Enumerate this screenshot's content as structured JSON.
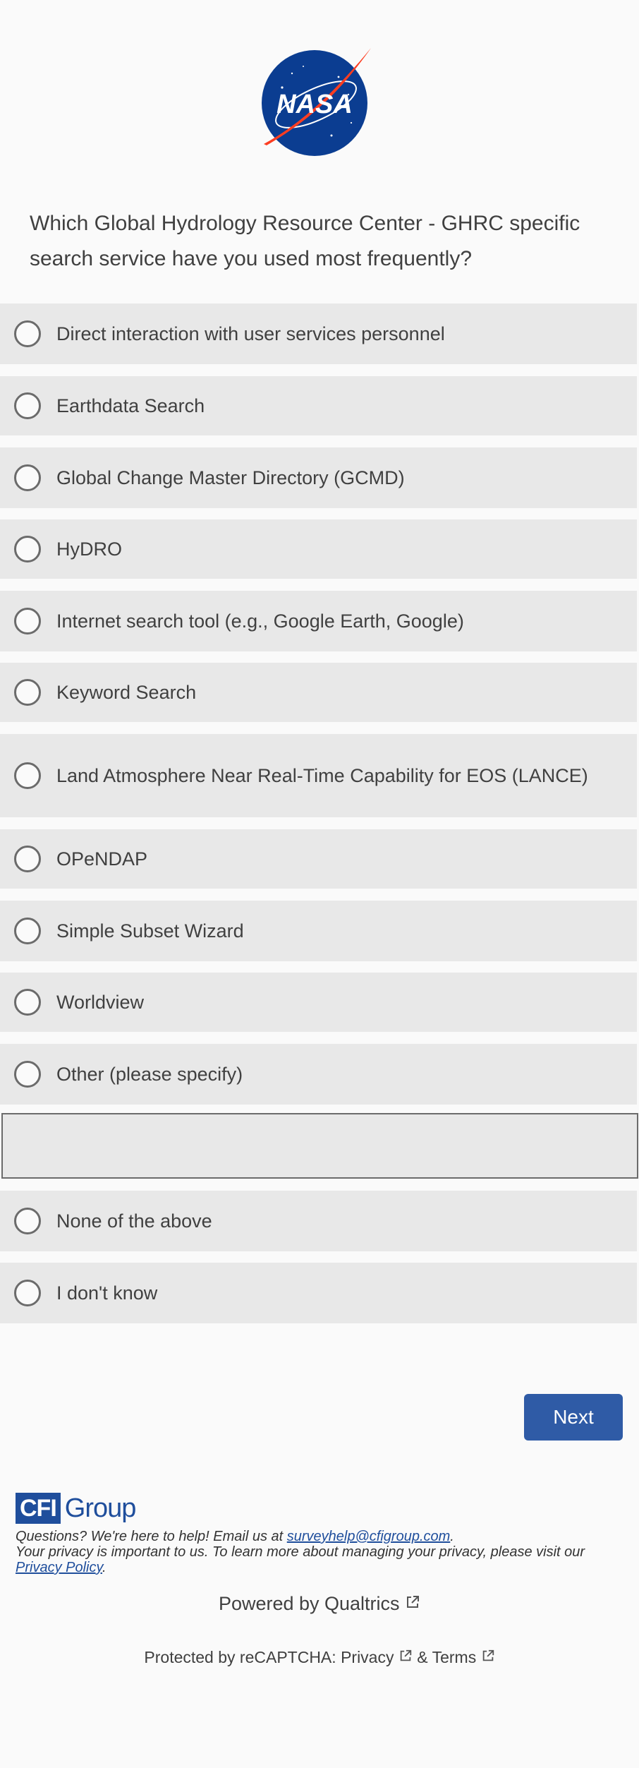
{
  "logo": {
    "alt": "NASA",
    "colors": {
      "blue": "#0b3d91",
      "red": "#fc3d21"
    }
  },
  "question": {
    "text": "Which Global Hydrology Resource Center - GHRC specific search service have you used most frequently?"
  },
  "choices": [
    {
      "label": "Direct interaction with user services personnel"
    },
    {
      "label": "Earthdata Search"
    },
    {
      "label": "Global Change Master Directory (GCMD)"
    },
    {
      "label": "HyDRO"
    },
    {
      "label": "Internet search tool (e.g., Google Earth, Google)"
    },
    {
      "label": "Keyword Search"
    },
    {
      "label": "Land Atmosphere Near Real-Time Capability for EOS (LANCE)"
    },
    {
      "label": "OPeNDAP"
    },
    {
      "label": "Simple Subset Wizard"
    },
    {
      "label": "Worldview"
    },
    {
      "label": "Other (please specify)"
    },
    {
      "label": "None of the above"
    },
    {
      "label": "I don't know"
    }
  ],
  "other_input": {
    "value": ""
  },
  "buttons": {
    "next": "Next"
  },
  "footer": {
    "brand_box": "CFI",
    "brand_word": "Group",
    "questions_text": "Questions? We're here to help! Email us at",
    "email": "surveyhelp@cfigroup.com",
    "privacy_text": "Your privacy is important to us. To learn more about managing your privacy, please visit our",
    "privacy_link": "Privacy Policy",
    "powered_by": "Powered by Qualtrics",
    "recaptcha_prefix": "Protected by reCAPTCHA:",
    "recaptcha_privacy": "Privacy",
    "recaptcha_amp": "&",
    "recaptcha_terms": "Terms"
  },
  "colors": {
    "accent": "#2f5ba6",
    "choice_bg": "#e8e8e8",
    "page_bg": "#fafafa"
  }
}
